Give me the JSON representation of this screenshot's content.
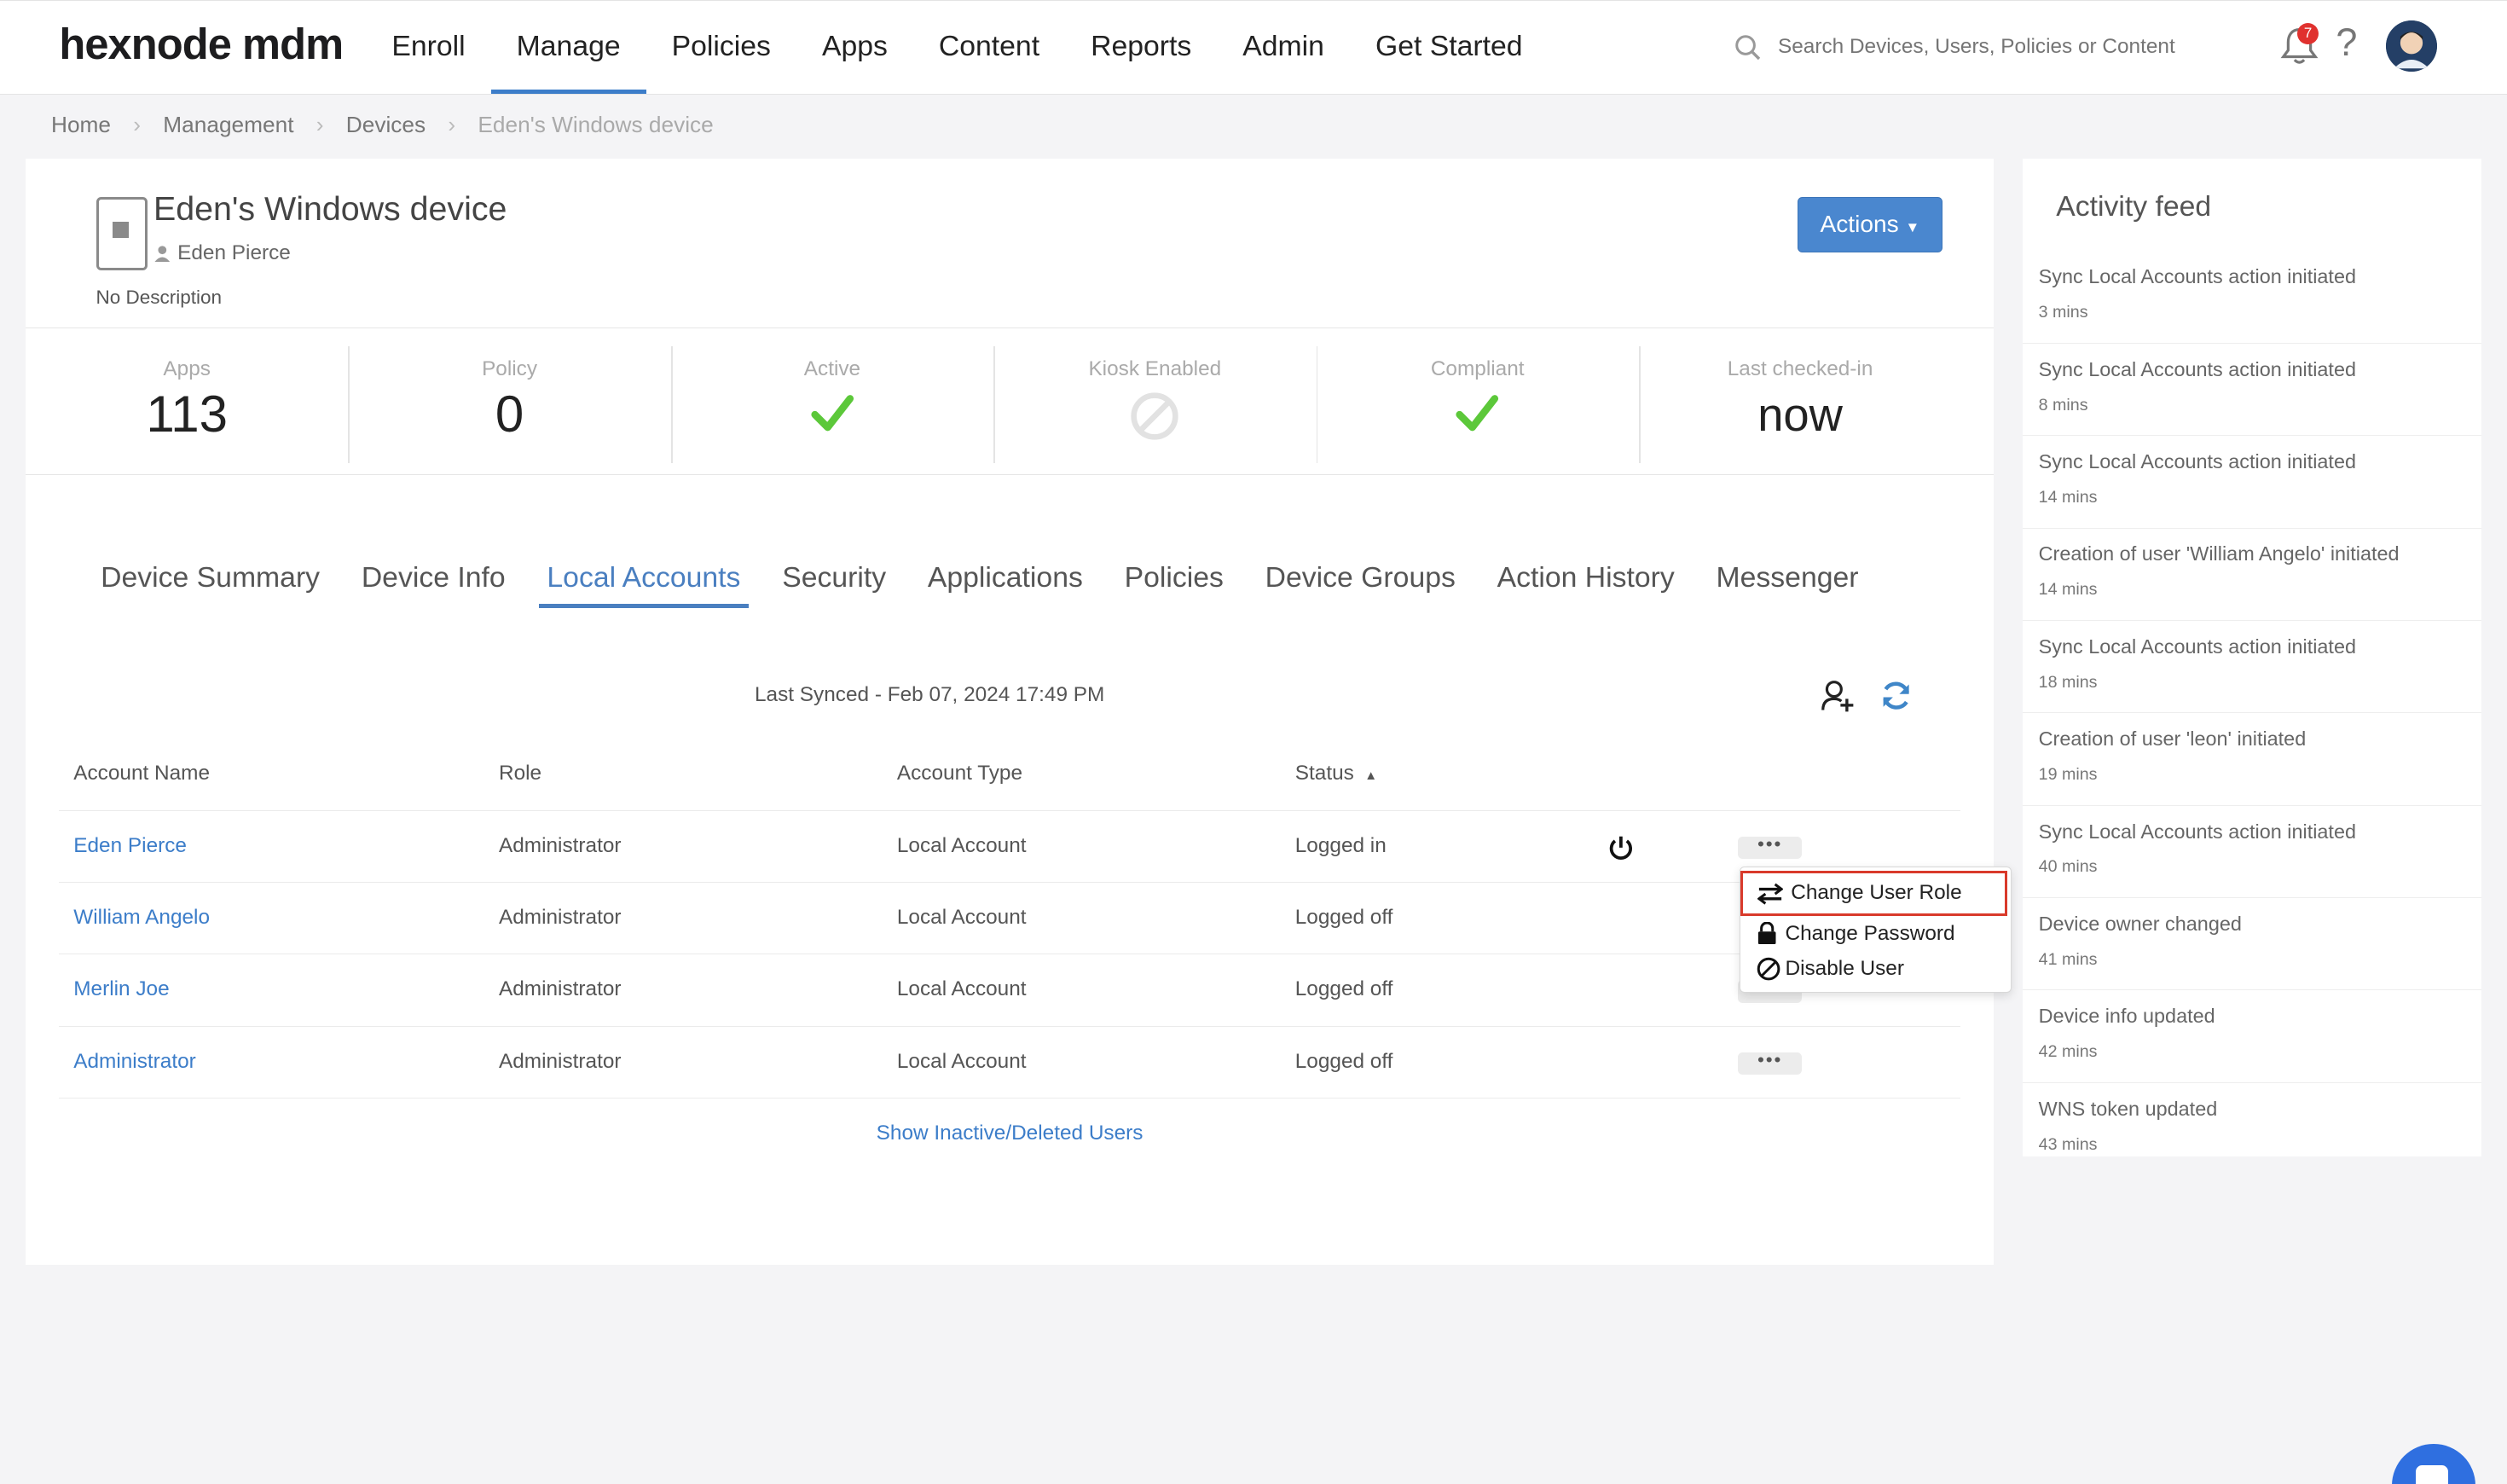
{
  "brand": "hexnode mdm",
  "nav": {
    "items": [
      "Enroll",
      "Manage",
      "Policies",
      "Apps",
      "Content",
      "Reports",
      "Admin",
      "Get Started"
    ],
    "active": "Manage",
    "search_placeholder": "Search Devices, Users, Policies or Content",
    "notification_count": "7"
  },
  "breadcrumb": [
    "Home",
    "Management",
    "Devices",
    "Eden's Windows device"
  ],
  "device": {
    "name": "Eden's Windows device",
    "owner": "Eden Pierce",
    "description": "No Description",
    "actions_label": "Actions"
  },
  "stats": {
    "apps": {
      "label": "Apps",
      "value": "113"
    },
    "policy": {
      "label": "Policy",
      "value": "0"
    },
    "active": {
      "label": "Active",
      "icon": "check-icon"
    },
    "kiosk": {
      "label": "Kiosk Enabled",
      "icon": "disabled-icon"
    },
    "compliant": {
      "label": "Compliant",
      "icon": "check-icon"
    },
    "last_checkin": {
      "label": "Last checked-in",
      "value": "now"
    }
  },
  "tabs": [
    "Device Summary",
    "Device Info",
    "Local Accounts",
    "Security",
    "Applications",
    "Policies",
    "Device Groups",
    "Action History",
    "Messenger"
  ],
  "active_tab": "Local Accounts",
  "local_accounts": {
    "last_synced": "Last Synced - Feb 07, 2024 17:49 PM",
    "columns": [
      "Account Name",
      "Role",
      "Account Type",
      "Status"
    ],
    "rows": [
      {
        "name": "Eden Pierce",
        "role": "Administrator",
        "type": "Local Account",
        "status": "Logged in"
      },
      {
        "name": "William Angelo",
        "role": "Administrator",
        "type": "Local Account",
        "status": "Logged off"
      },
      {
        "name": "Merlin Joe",
        "role": "Administrator",
        "type": "Local Account",
        "status": "Logged off"
      },
      {
        "name": "Administrator",
        "role": "Administrator",
        "type": "Local Account",
        "status": "Logged off"
      }
    ],
    "more_label": "•••",
    "show_inactive": "Show Inactive/Deleted Users"
  },
  "row_menu": {
    "items": [
      "Change User Role",
      "Change Password",
      "Disable User"
    ],
    "highlighted": "Change User Role"
  },
  "activity_feed": {
    "title": "Activity feed",
    "items": [
      {
        "text": "Sync Local Accounts action initiated",
        "time": "3 mins"
      },
      {
        "text": "Sync Local Accounts action initiated",
        "time": "8 mins"
      },
      {
        "text": "Sync Local Accounts action initiated",
        "time": "14 mins"
      },
      {
        "text": "Creation of user 'William Angelo' initiated",
        "time": "14 mins"
      },
      {
        "text": "Sync Local Accounts action initiated",
        "time": "18 mins"
      },
      {
        "text": "Creation of user 'leon' initiated",
        "time": "19 mins"
      },
      {
        "text": "Sync Local Accounts action initiated",
        "time": "40 mins"
      },
      {
        "text": "Device owner changed",
        "time": "41 mins"
      },
      {
        "text": "Device info updated",
        "time": "42 mins"
      },
      {
        "text": "WNS token updated",
        "time": "43 mins"
      }
    ]
  },
  "colors": {
    "accent": "#3c7dc9",
    "button": "#4a87cf",
    "check": "#5cc83a",
    "highlight": "#d93a2b"
  }
}
